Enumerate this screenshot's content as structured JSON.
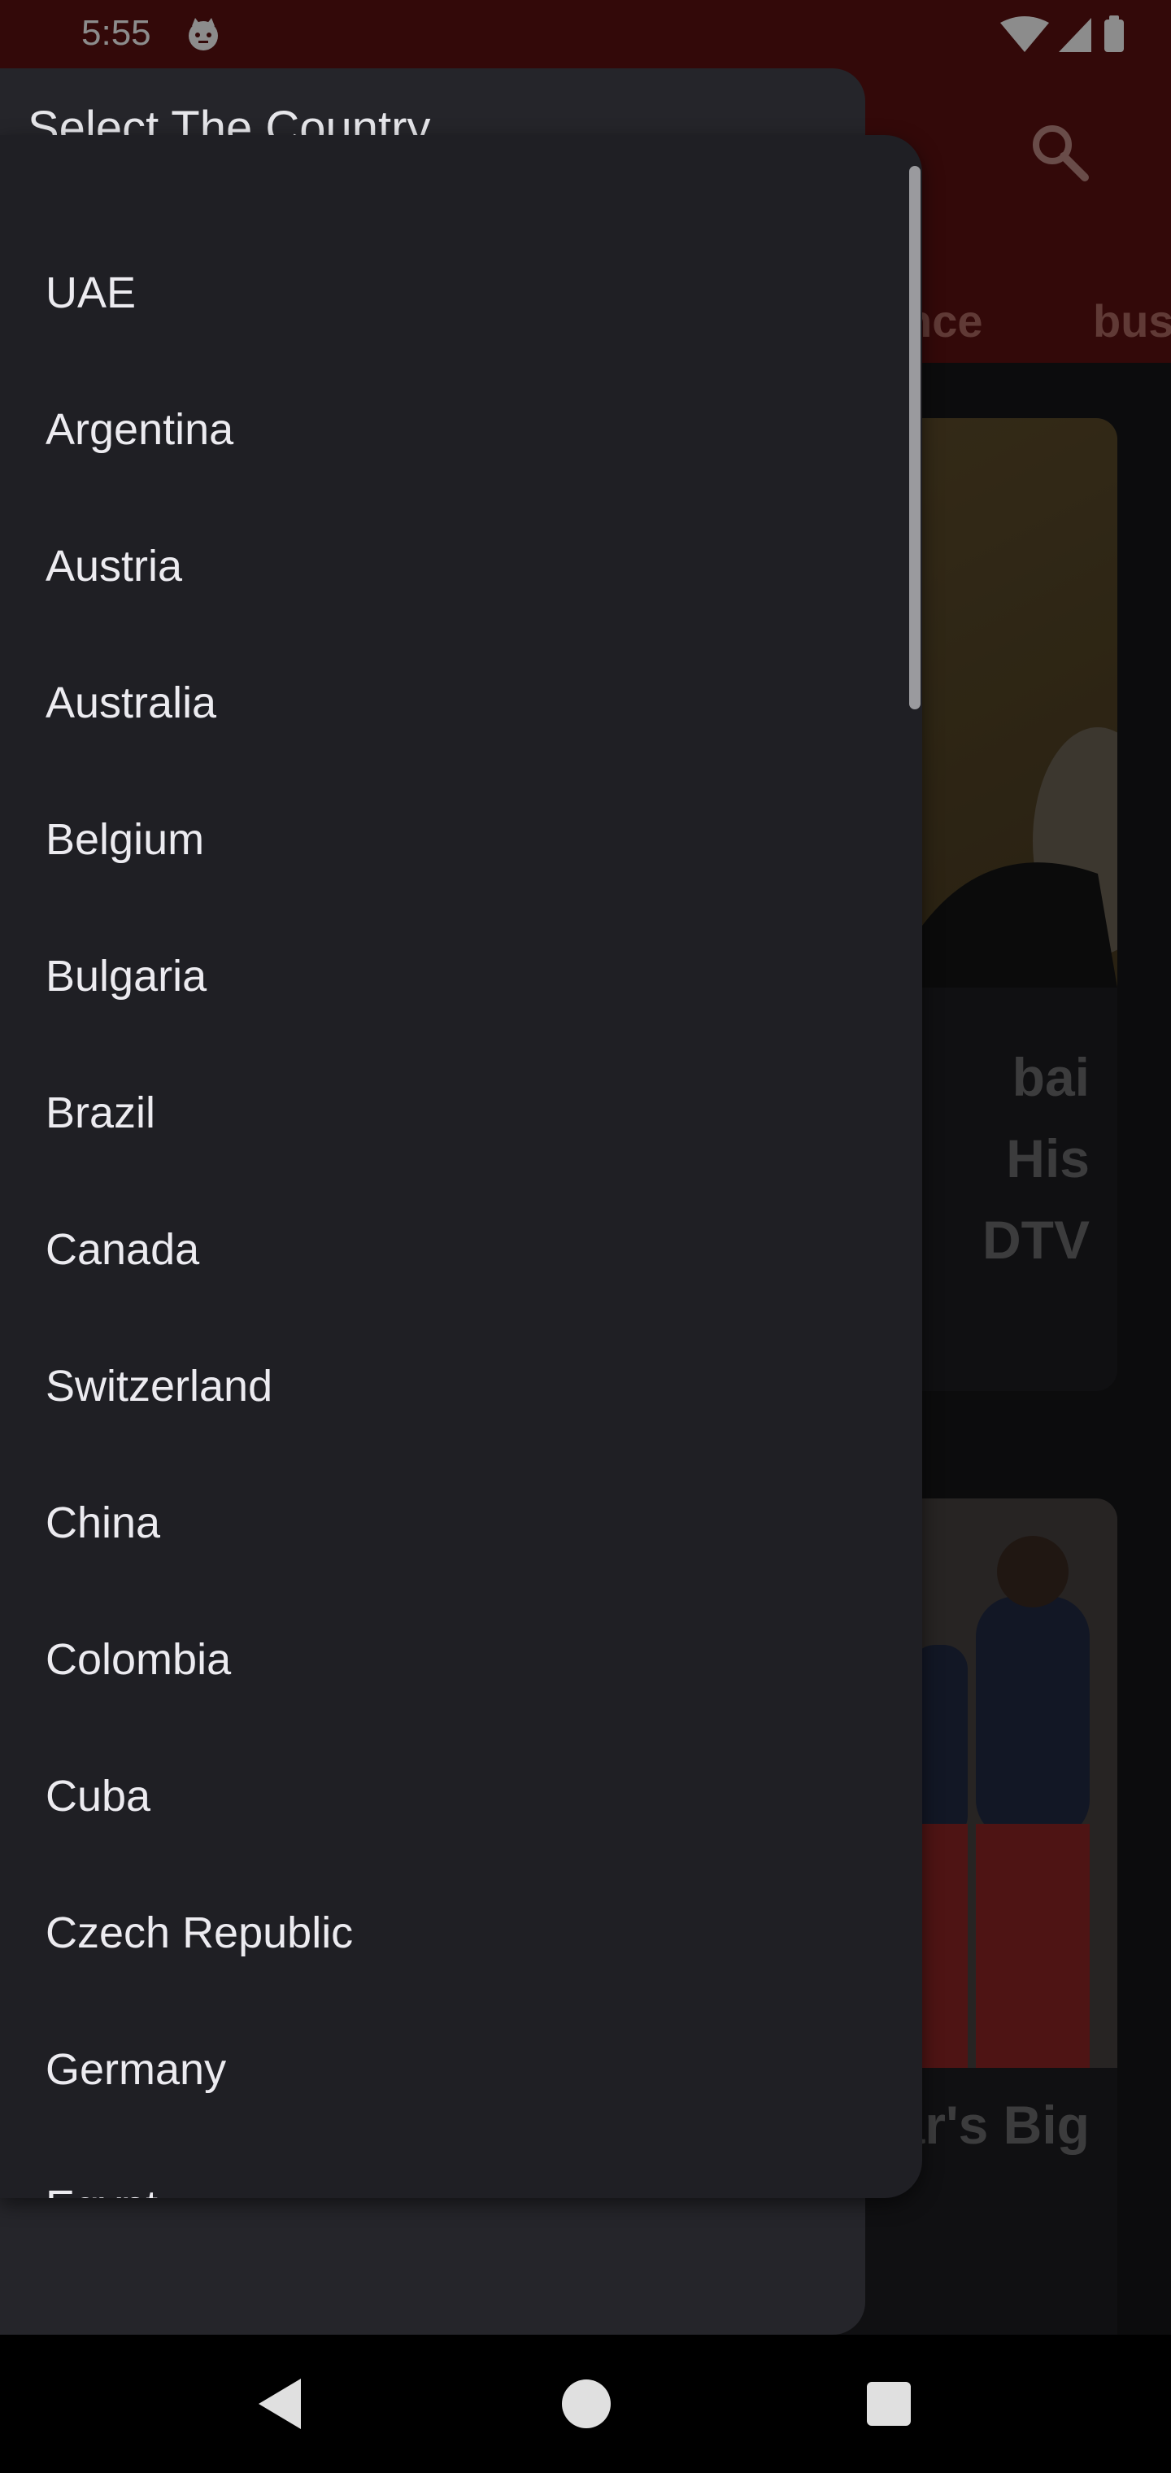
{
  "status_bar": {
    "time": "5:55"
  },
  "background": {
    "tabs": [
      "nce",
      "bus"
    ],
    "cards": [
      {
        "title": "bai\nHis\nDTV"
      },
      {
        "title": "Star's Big"
      }
    ]
  },
  "dialog": {
    "title": "Select The Country",
    "options": [
      "UAE",
      "Argentina",
      "Austria",
      "Australia",
      "Belgium",
      "Bulgaria",
      "Brazil",
      "Canada",
      "Switzerland",
      "China",
      "Colombia",
      "Cuba",
      "Czech Republic",
      "Germany",
      "Egypt"
    ]
  },
  "colors": {
    "app_bar": "#5e1111",
    "dialog_bg": "#25252a",
    "dropdown_bg": "#1f1f24",
    "option_text": "#ecebf0"
  },
  "icons": {
    "status": [
      "cat-notification-icon",
      "wifi-icon",
      "signal-icon",
      "battery-icon"
    ],
    "app_bar": [
      "search-icon"
    ],
    "nav": [
      "back-icon",
      "home-icon",
      "recents-icon"
    ]
  }
}
